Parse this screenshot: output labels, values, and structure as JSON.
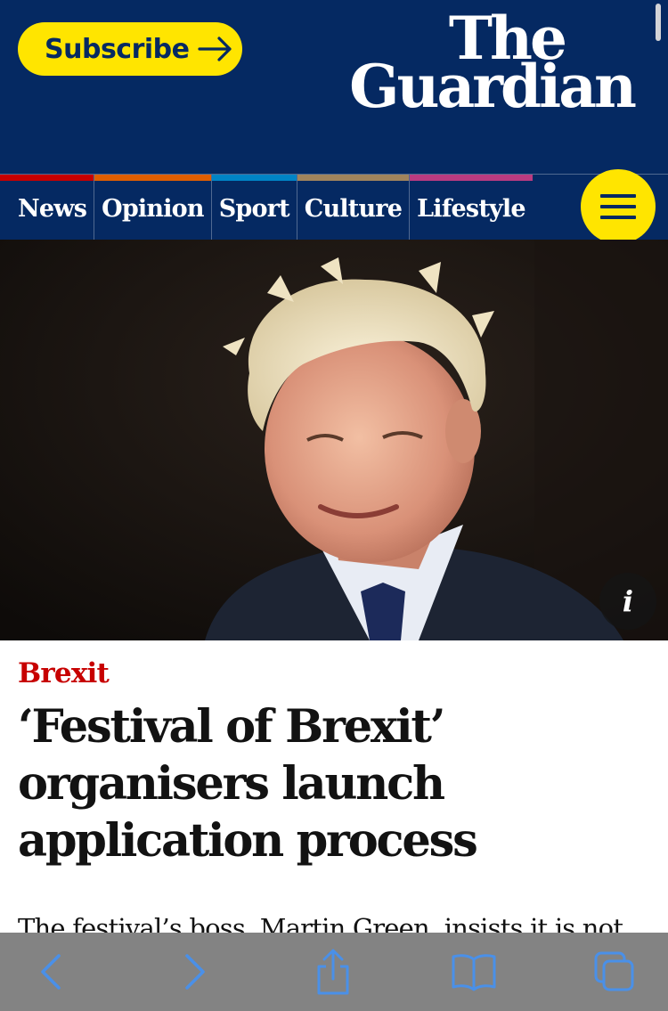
{
  "header": {
    "subscribe_label": "Subscribe",
    "logo_line1": "The",
    "logo_line2": "Guardian",
    "brand_color": "#052962",
    "accent_color": "#ffe500"
  },
  "nav": {
    "items": [
      {
        "label": "News",
        "pillar_color": "#c70000"
      },
      {
        "label": "Opinion",
        "pillar_color": "#e05e00"
      },
      {
        "label": "Sport",
        "pillar_color": "#0084c6"
      },
      {
        "label": "Culture",
        "pillar_color": "#a1845c"
      },
      {
        "label": "Lifestyle",
        "pillar_color": "#bb3b80"
      }
    ],
    "menu_icon": "hamburger-icon"
  },
  "hero": {
    "info_label": "i"
  },
  "article": {
    "kicker": "Brexit",
    "kicker_color": "#c70000",
    "headline_lines": [
      "‘Festival of Brexit’",
      "organisers launch",
      "application process"
    ],
    "standfirst": "The festival’s boss, Martin Green, insists it is not"
  },
  "toolbar": {
    "icons": [
      "back-icon",
      "forward-icon",
      "share-icon",
      "bookmarks-icon",
      "tabs-icon"
    ],
    "icon_color": "#4a90e8"
  }
}
